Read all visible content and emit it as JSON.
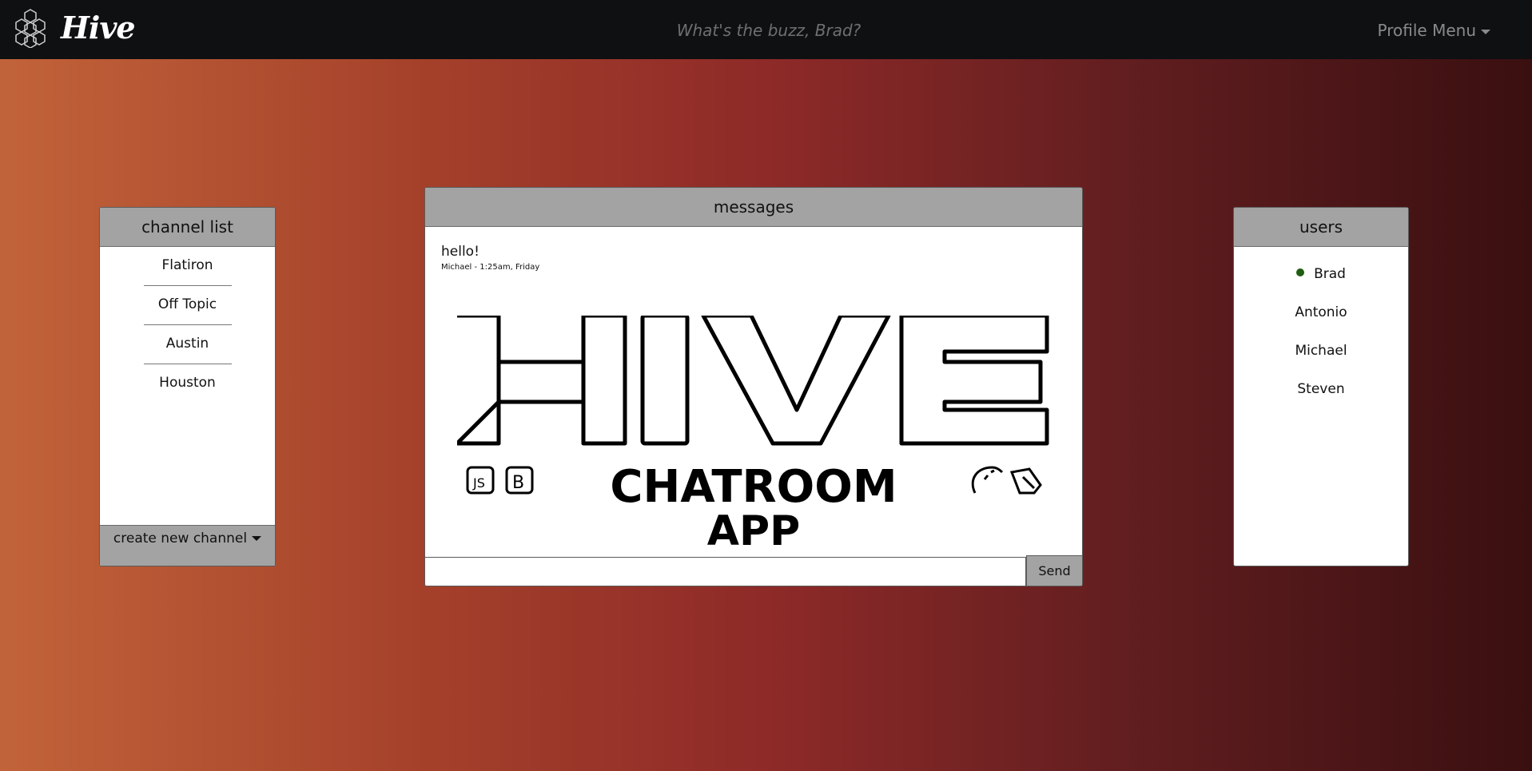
{
  "navbar": {
    "brand": "Hive",
    "search_placeholder": "What's the buzz, Brad?",
    "profile_menu": "Profile Menu"
  },
  "channels": {
    "title": "channel list",
    "items": [
      "Flatiron",
      "Off Topic",
      "Austin",
      "Houston"
    ],
    "create_label": "create new channel"
  },
  "messages": {
    "title": "messages",
    "items": [
      {
        "text": "hello!",
        "meta": "Michael - 1:25am, Friday"
      }
    ],
    "logo": {
      "title": "HIVE",
      "subtitle_line1": "CHATROOM",
      "subtitle_line2": "APP",
      "badge_js": "JS",
      "badge_b": "B"
    },
    "input_value": "",
    "send_label": "Send"
  },
  "users": {
    "title": "users",
    "items": [
      {
        "name": "Brad",
        "online": true
      },
      {
        "name": "Antonio",
        "online": false
      },
      {
        "name": "Michael",
        "online": false
      },
      {
        "name": "Steven",
        "online": false
      }
    ]
  },
  "colors": {
    "navbar_bg": "#0e1012",
    "panel_header": "#a3a3a3",
    "online_indicator": "#1e5e12"
  },
  "icons": [
    "honeycomb-logo-icon",
    "caret-down-icon",
    "javascript-icon",
    "bootstrap-icon",
    "rails-icon",
    "postgres-icon",
    "online-status-icon"
  ]
}
